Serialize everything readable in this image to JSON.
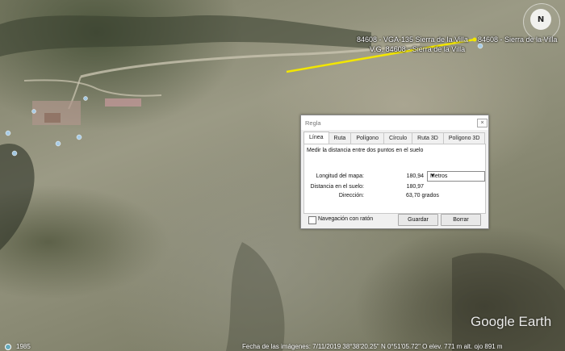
{
  "map": {
    "placemark_labels": [
      "84608 - VGA-135 Sierra de la Villa",
      "84608 - Sierra de la Villa",
      "V.G. 84608 - Sierra de la Villa"
    ],
    "compass_label": "N",
    "watermark": "Google Earth",
    "status_bar": {
      "year": "1985",
      "text": "Fecha de las imágenes: 7/11/2019    38°38'20.25\" N    0°51'05.72\" O  elev.  771 m    alt. ojo   891 m"
    },
    "colors": {
      "measure_line": "#f2e600"
    }
  },
  "dialog": {
    "title": "Regla",
    "close_label": "×",
    "tabs": [
      "Línea",
      "Ruta",
      "Polígono",
      "Círculo",
      "Ruta 3D",
      "Polígono 3D"
    ],
    "active_tab": "Línea",
    "description": "Medir la distancia entre dos puntos en el suelo",
    "map_length_label": "Longitud del mapa:",
    "map_length_value": "180,94",
    "unit": "Metros",
    "ground_length_label": "Distancia en el suelo:",
    "ground_length_value": "180,97",
    "heading_label": "Dirección:",
    "heading_value": "63,70 grados",
    "mouse_nav_label": "Navegación con ratón",
    "save_label": "Guardar",
    "clear_label": "Borrar"
  }
}
